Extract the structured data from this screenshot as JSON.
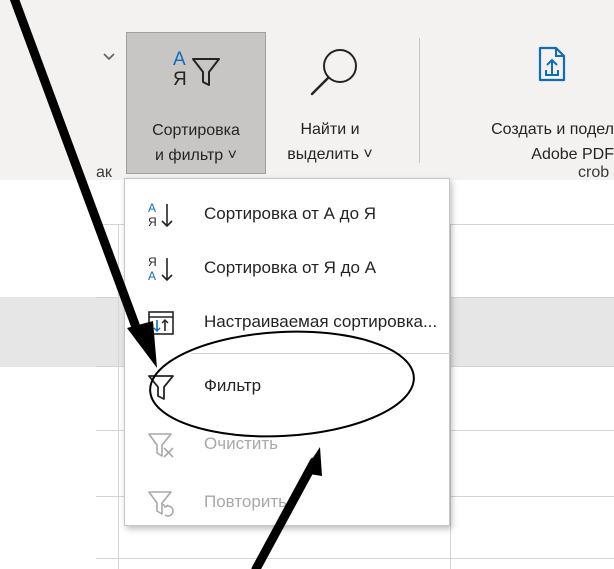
{
  "ribbon": {
    "sort_filter": {
      "line1": "Сортировка",
      "line2": "и фильтр ˅"
    },
    "find_select": {
      "line1": "Найти и",
      "line2": "выделить ˅"
    },
    "adobe": {
      "line1": "Создать и подел",
      "line2": "Adobe PDF"
    },
    "group_fragment_left": "ак",
    "group_fragment_right": "crob",
    "chevron": "˅"
  },
  "menu": {
    "items": [
      {
        "label": "Сортировка от А до Я",
        "enabled": true,
        "icon": "sort-ascending-icon"
      },
      {
        "label": "Сортировка от Я до А",
        "enabled": true,
        "icon": "sort-descending-icon"
      },
      {
        "label": "Настраиваемая сортировка...",
        "enabled": true,
        "icon": "custom-sort-icon"
      },
      {
        "label": "Фильтр",
        "enabled": true,
        "icon": "filter-funnel-icon"
      },
      {
        "label": "Очистить",
        "enabled": false,
        "icon": "clear-filter-icon"
      },
      {
        "label": "Повторить",
        "enabled": false,
        "icon": "reapply-filter-icon"
      }
    ]
  },
  "colors": {
    "ribbon_bg": "#f3f2f1",
    "button_pressed": "#c8c6c4",
    "accent_blue": "#0f6cbd",
    "disabled_text": "#a8a8a8",
    "annotation": "#000000"
  }
}
